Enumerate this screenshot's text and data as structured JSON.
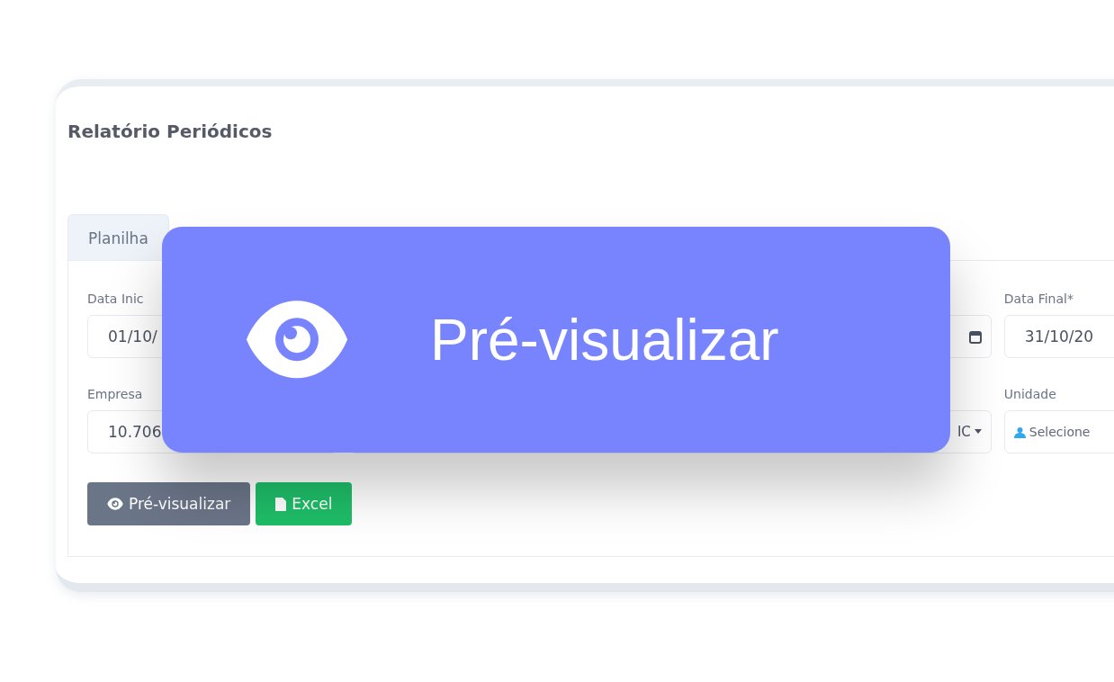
{
  "page": {
    "title": "Relatório Periódicos"
  },
  "tabs": [
    {
      "label": "Planilha",
      "selected": true
    }
  ],
  "rows": [
    [
      {
        "kind": "input",
        "label": "Data Inic",
        "value": "01/10/"
      },
      {
        "kind": "date"
      },
      {
        "kind": "input",
        "label": "Data Final*",
        "value": "31/10/20"
      }
    ],
    [
      {
        "kind": "input",
        "label": "Empresa",
        "value": "10.706"
      },
      {
        "kind": "select",
        "value": "IC"
      },
      {
        "kind": "picker",
        "label": "Unidade",
        "placeholder": "Selecione"
      }
    ]
  ],
  "buttons": [
    {
      "label": "Pré-visualizar",
      "kind": "secondary"
    },
    {
      "label": "Excel",
      "kind": "success"
    }
  ],
  "overlay": {
    "label": "Pré-visualizar"
  }
}
